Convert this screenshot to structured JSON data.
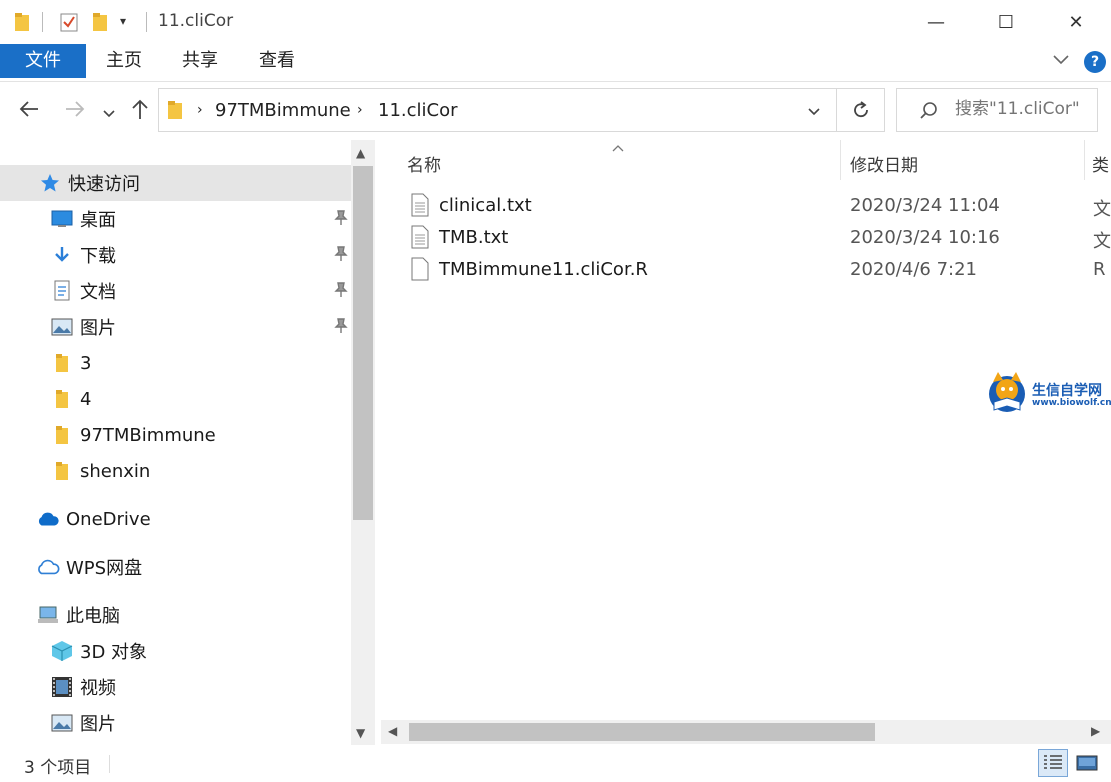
{
  "window": {
    "title": "11.cliCor",
    "minimize_glyph": "—",
    "maximize_glyph": "☐",
    "close_glyph": "✕"
  },
  "ribbon": {
    "tabs": [
      {
        "label": "文件",
        "active": true
      },
      {
        "label": "主页",
        "active": false
      },
      {
        "label": "共享",
        "active": false
      },
      {
        "label": "查看",
        "active": false
      }
    ]
  },
  "address": {
    "crumbs": [
      "97TMBimmune",
      "11.cliCor"
    ],
    "search_placeholder": "搜索\"11.cliCor\""
  },
  "nav": {
    "quick_access": "快速访问",
    "pinned": [
      {
        "label": "桌面",
        "icon": "desktop-icon"
      },
      {
        "label": "下载",
        "icon": "download-icon"
      },
      {
        "label": "文档",
        "icon": "document-icon"
      },
      {
        "label": "图片",
        "icon": "pictures-icon"
      }
    ],
    "folders": [
      "3",
      "4",
      "97TMBimmune",
      "shenxin"
    ],
    "onedrive": "OneDrive",
    "wps": "WPS网盘",
    "this_pc": "此电脑",
    "pc_items": [
      {
        "label": "3D 对象",
        "icon": "3d-objects-icon"
      },
      {
        "label": "视频",
        "icon": "video-icon"
      },
      {
        "label": "图片",
        "icon": "pictures-icon"
      }
    ]
  },
  "columns": {
    "name": "名称",
    "date": "修改日期",
    "type": "类"
  },
  "files": [
    {
      "name": "clinical.txt",
      "date": "2020/3/24 11:04",
      "type": "文"
    },
    {
      "name": "TMB.txt",
      "date": "2020/3/24 10:16",
      "type": "文"
    },
    {
      "name": "TMBimmune11.cliCor.R",
      "date": "2020/4/6 7:21",
      "type": "R"
    }
  ],
  "status": {
    "count": "3 个项目"
  },
  "logo": {
    "name": "生信自学网",
    "url": "www.biowolf.cn"
  },
  "colors": {
    "accent": "#1a6fc7",
    "folder": "#f4c542",
    "selection": "#e5e5e5"
  }
}
